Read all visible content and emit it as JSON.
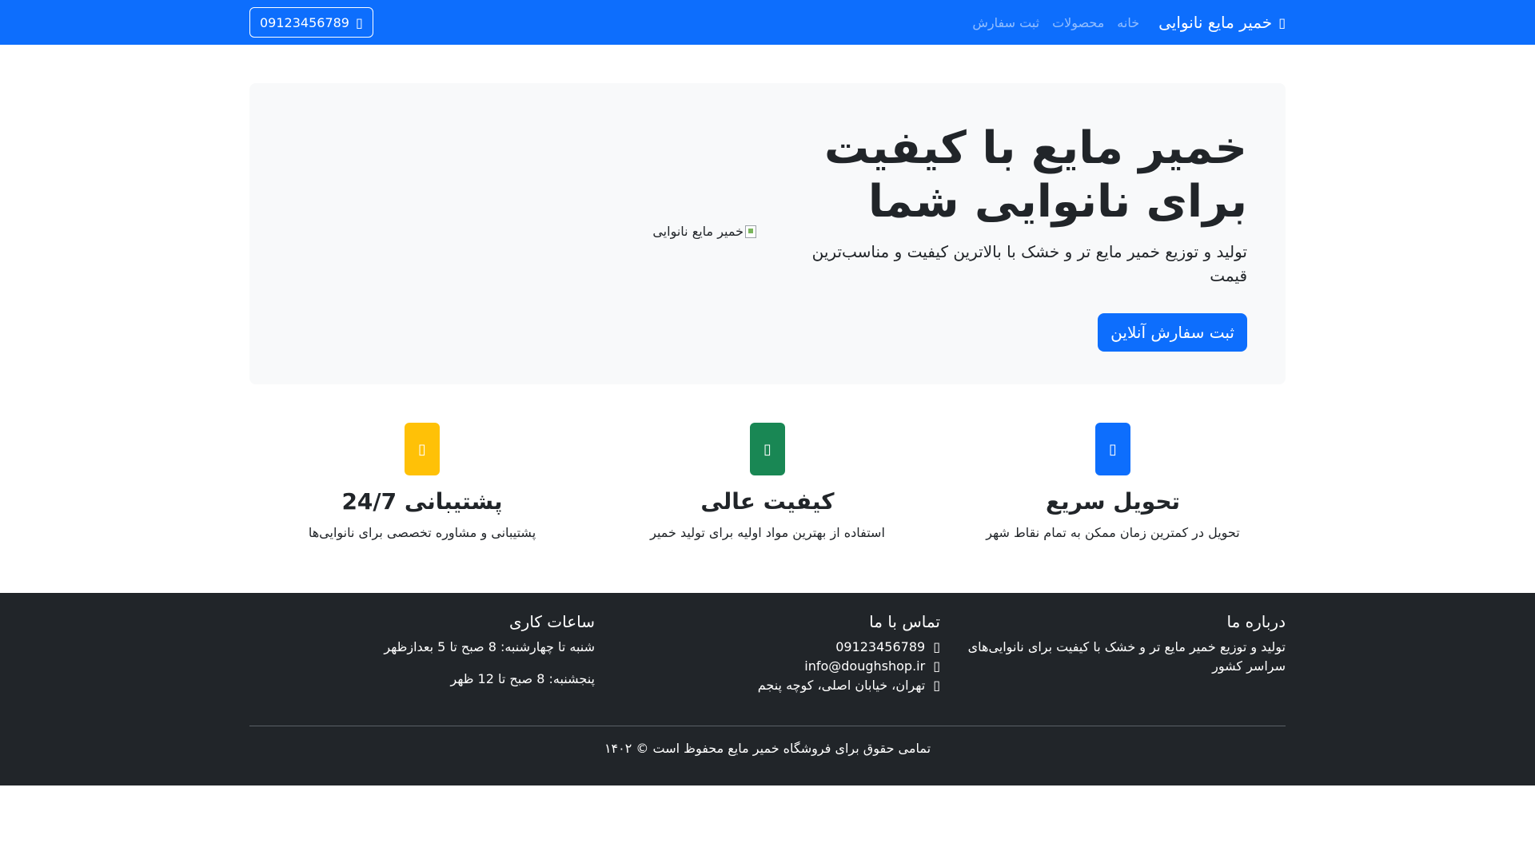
{
  "navbar": {
    "brand": "خمیر مایع نانوایی",
    "brand_icon": "shop-icon",
    "links": [
      "خانه",
      "محصولات",
      "ثبت سفارش"
    ],
    "phone": "09123456789",
    "phone_icon": "phone-icon"
  },
  "hero": {
    "title_line1": "خمیر مایع با کیفیت",
    "title_line2": "برای نانوایی شما",
    "lead": "تولید و توزیع خمیر مایع تر و خشک با بالاترین کیفیت و مناسب‌ترین قیمت",
    "cta": "ثبت سفارش آنلاین",
    "image_alt": "خمیر مایع نانوایی"
  },
  "features": [
    {
      "title": "تحویل سریع",
      "desc": "تحویل در کمترین زمان ممکن به تمام نقاط شهر",
      "icon": "truck-icon",
      "color": "#0d6efd"
    },
    {
      "title": "کیفیت عالی",
      "desc": "استفاده از بهترین مواد اولیه برای تولید خمیر",
      "icon": "award-icon",
      "color": "#198754"
    },
    {
      "title": "پشتیبانی 24/7",
      "desc": "پشتیبانی و مشاوره تخصصی برای نانوایی‌ها",
      "icon": "headset-icon",
      "color": "#ffc107"
    }
  ],
  "footer": {
    "about_title": "درباره ما",
    "about_text": "تولید و توزیع خمیر مایع تر و خشک با کیفیت برای نانوایی‌های سراسر کشور",
    "contact_title": "تماس با ما",
    "contact_phone": "09123456789",
    "contact_email": "info@doughshop.ir",
    "contact_address": "تهران، خیابان اصلی، کوچه پنجم",
    "hours_title": "ساعات کاری",
    "hours_line1": "شنبه تا چهارشنبه: 8 صبح تا 5 بعدازظهر",
    "hours_line2": "پنجشنبه: 8 صبح تا 12 ظهر",
    "copyright": "تمامی حقوق برای فروشگاه خمیر مایع محفوظ است © ۱۴۰۲"
  }
}
